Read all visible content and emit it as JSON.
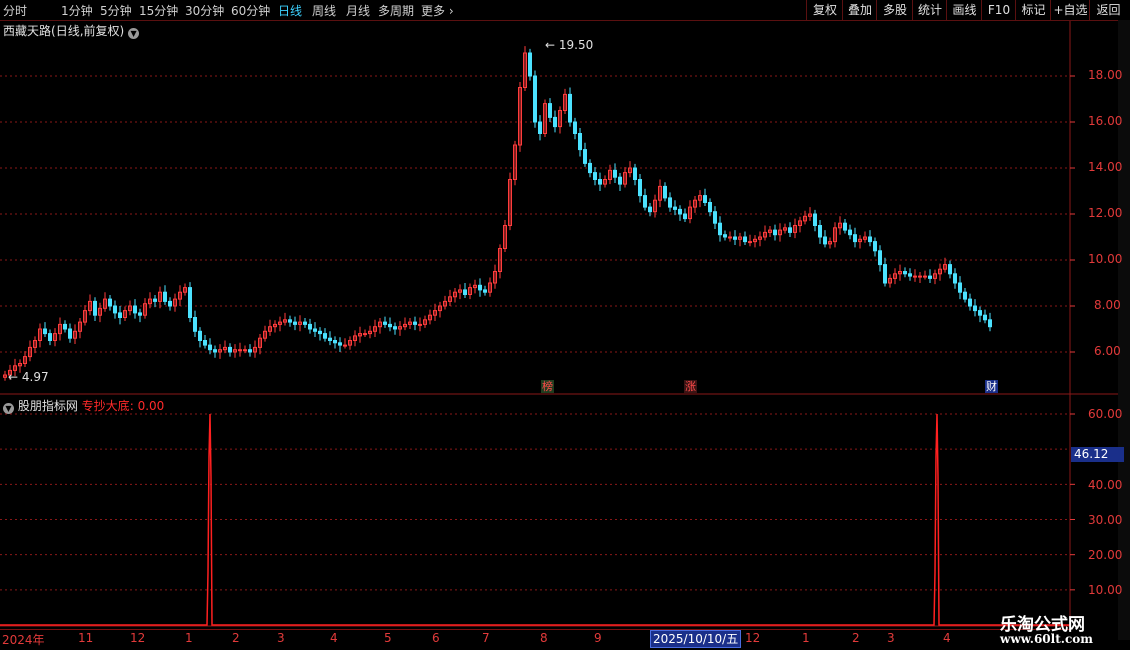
{
  "toolbar": {
    "periods": [
      "分时",
      "1分钟",
      "5分钟",
      "15分钟",
      "30分钟",
      "60分钟",
      "日线",
      "周线",
      "月线",
      "多周期",
      "更多"
    ],
    "active_period": "日线",
    "buttons": [
      "复权",
      "叠加",
      "多股",
      "统计",
      "画线",
      "F10",
      "标记",
      "+自选",
      "返回"
    ]
  },
  "main_chart": {
    "stock_name": "西藏天路",
    "mode": "(日线,前复权)",
    "high_label": "19.50",
    "low_label": "4.97",
    "y_ticks": [
      "18.00",
      "16.00",
      "14.00",
      "12.00",
      "10.00",
      "8.00",
      "6.00"
    ],
    "badges": [
      {
        "text": "榜",
        "color": "#ff4444"
      },
      {
        "text": "涨",
        "color": "#ff4444"
      },
      {
        "text": "财",
        "color": "#ffffff"
      }
    ]
  },
  "sub_chart": {
    "indicator_name": "股朋指标网",
    "line_label": "专抄大底",
    "line_value": "0.00",
    "y_ticks": [
      "60.00",
      "40.00",
      "30.00",
      "20.00",
      "10.00"
    ],
    "readout": "46.12"
  },
  "x_axis": {
    "labels": [
      "2024年",
      "11",
      "12",
      "1",
      "2",
      "3",
      "4",
      "5",
      "6",
      "7",
      "8",
      "9",
      "12",
      "1",
      "2",
      "3",
      "4"
    ],
    "highlight": "2025/10/10/五"
  },
  "watermark": {
    "text": "乐淘公式网",
    "url": "www.60lt.com"
  },
  "colors": {
    "up": "#ff3c3c",
    "down": "#4ce2ff",
    "axis": "#e23a3a",
    "grid": "#8a1818",
    "indicator": "#ff2020"
  },
  "chart_data": [
    {
      "type": "candlestick",
      "ylim": [
        4.5,
        20.0
      ],
      "x": [
        0,
        5,
        10,
        15,
        20,
        25,
        30,
        35,
        40,
        45,
        50,
        55,
        60,
        65,
        70,
        75,
        80,
        85,
        90,
        95,
        100,
        105,
        110,
        115,
        120,
        125,
        130,
        135,
        140,
        145,
        150,
        155,
        160,
        165,
        170,
        175,
        180,
        185,
        190,
        195,
        200,
        205,
        210,
        215,
        220,
        225,
        230,
        235,
        240,
        245,
        250,
        255,
        260,
        265,
        270,
        275,
        280,
        285,
        290,
        295,
        300,
        305,
        310,
        315,
        320,
        325,
        330,
        335,
        340,
        345,
        350,
        355,
        360,
        365,
        370,
        375,
        380,
        385,
        390,
        395,
        400,
        405,
        410,
        415,
        420,
        425,
        430,
        435,
        440,
        445,
        450,
        455,
        460,
        465,
        470,
        475,
        480,
        485,
        490,
        495,
        500,
        505,
        510,
        515,
        520,
        525,
        530,
        535,
        540,
        545,
        550,
        555,
        560,
        565,
        570,
        575,
        580,
        585,
        590,
        595,
        600,
        605,
        610,
        615,
        620,
        625,
        630,
        635,
        640,
        645,
        650,
        655,
        660,
        665,
        670,
        675,
        680,
        685,
        690,
        695,
        700,
        705,
        710,
        715,
        720,
        725,
        730,
        735,
        740,
        745,
        750,
        755,
        760,
        765,
        770,
        775,
        780,
        785,
        790,
        795,
        800,
        805,
        810,
        815,
        820,
        825,
        830,
        835,
        840,
        845,
        850,
        855,
        860,
        865,
        870,
        875,
        880,
        885,
        890,
        895,
        900,
        905,
        910,
        915,
        920,
        925,
        930,
        935,
        940,
        945,
        950,
        955,
        960,
        965,
        970,
        975,
        980,
        985,
        990,
        995,
        1000,
        1005,
        1010,
        1015,
        1020,
        1025,
        1030,
        1035,
        1040,
        1045,
        1050,
        1055,
        1060
      ],
      "close": [
        5.0,
        5.2,
        5.4,
        5.5,
        5.8,
        6.2,
        6.5,
        7.0,
        6.8,
        6.5,
        6.8,
        7.2,
        7.0,
        6.6,
        6.9,
        7.3,
        7.8,
        8.2,
        7.6,
        7.9,
        8.3,
        8.0,
        7.7,
        7.5,
        7.8,
        8.0,
        7.7,
        7.6,
        8.1,
        8.3,
        8.2,
        8.6,
        8.2,
        8.0,
        8.3,
        8.6,
        8.8,
        7.5,
        6.9,
        6.5,
        6.3,
        6.1,
        6.0,
        6.1,
        6.2,
        6.0,
        6.1,
        6.1,
        6.1,
        6.0,
        6.2,
        6.6,
        6.9,
        7.1,
        7.2,
        7.3,
        7.4,
        7.3,
        7.2,
        7.3,
        7.2,
        7.0,
        6.9,
        6.8,
        6.6,
        6.5,
        6.4,
        6.3,
        6.3,
        6.5,
        6.7,
        6.8,
        6.8,
        6.9,
        7.1,
        7.3,
        7.2,
        7.1,
        7.0,
        7.1,
        7.2,
        7.3,
        7.2,
        7.2,
        7.4,
        7.6,
        7.8,
        8.0,
        8.2,
        8.4,
        8.6,
        8.7,
        8.5,
        8.8,
        8.9,
        8.7,
        8.6,
        9.0,
        9.5,
        10.5,
        11.5,
        13.5,
        15.0,
        17.5,
        19.0,
        18.0,
        16.0,
        15.5,
        16.8,
        16.2,
        15.8,
        16.5,
        17.2,
        16.0,
        15.5,
        14.8,
        14.2,
        13.8,
        13.5,
        13.3,
        13.5,
        13.9,
        13.6,
        13.3,
        13.8,
        14.0,
        13.5,
        12.8,
        12.3,
        12.1,
        12.6,
        13.2,
        12.7,
        12.3,
        12.2,
        12.0,
        11.8,
        12.3,
        12.6,
        12.8,
        12.5,
        12.1,
        11.6,
        11.1,
        11.0,
        11.0,
        10.9,
        11.0,
        10.8,
        10.8,
        10.9,
        11.0,
        11.2,
        11.3,
        11.1,
        11.3,
        11.4,
        11.2,
        11.5,
        11.7,
        11.9,
        12.0,
        11.5,
        11.0,
        10.7,
        10.8,
        11.4,
        11.6,
        11.3,
        11.1,
        10.8,
        10.9,
        11.0,
        10.8,
        10.4,
        9.8,
        9.0,
        9.2,
        9.4,
        9.5,
        9.4,
        9.3,
        9.3,
        9.3,
        9.3,
        9.2,
        9.4,
        9.6,
        9.8,
        9.4,
        9.0,
        8.6,
        8.3,
        8.0,
        7.8,
        7.6,
        7.4,
        7.1
      ]
    },
    {
      "type": "line",
      "name": "专抄大底",
      "ylim": [
        0,
        65
      ],
      "peaks": [
        {
          "x": 205,
          "value": 60
        },
        {
          "x": 932,
          "value": 60
        }
      ]
    }
  ]
}
